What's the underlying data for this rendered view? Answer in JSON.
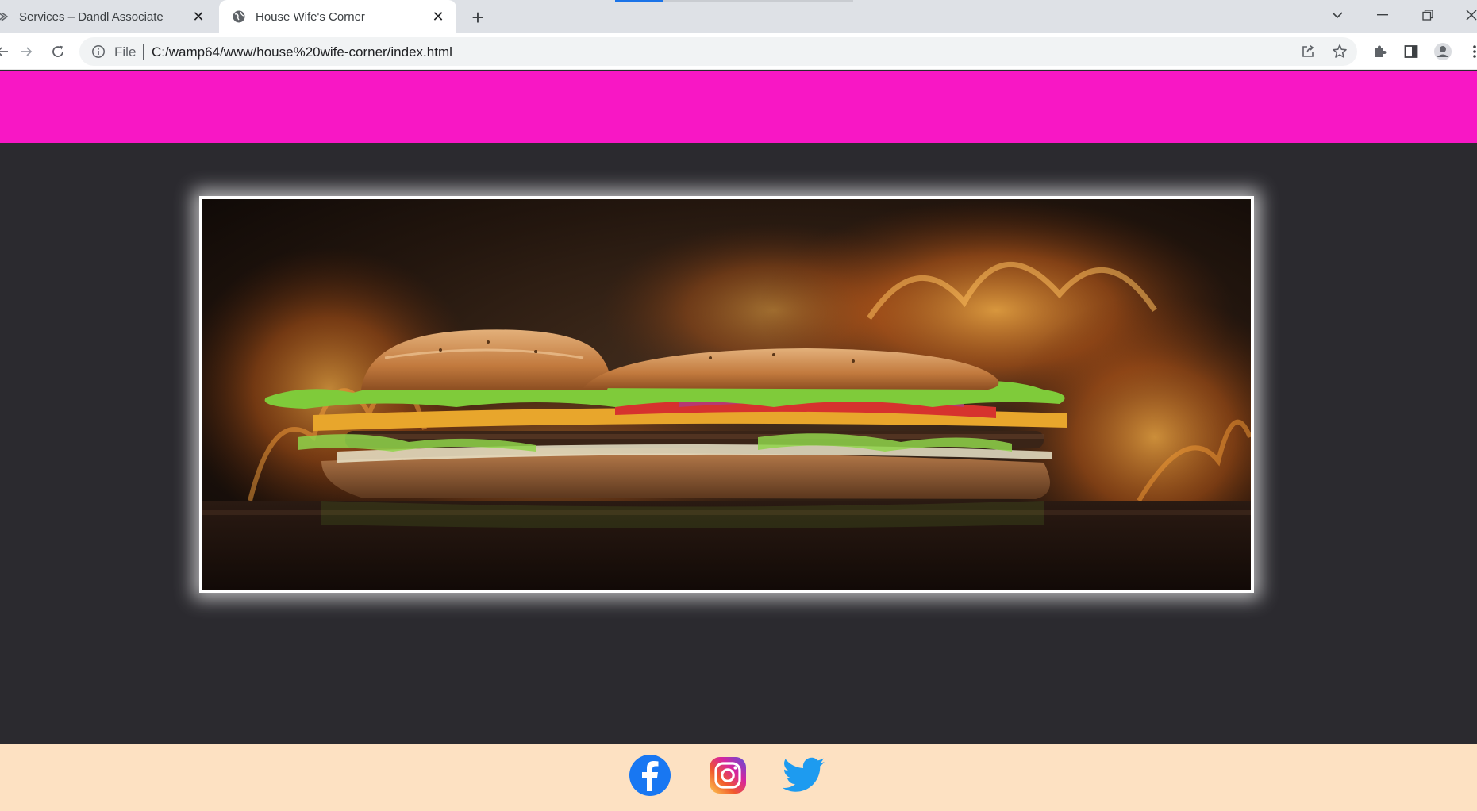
{
  "browser": {
    "tabs": [
      {
        "title": "Services – Dandl Associate",
        "active": false,
        "favicon": "site-favicon-icon"
      },
      {
        "title": "House Wife's Corner",
        "active": true,
        "favicon": "globe-icon"
      }
    ],
    "address": {
      "scheme_label": "File",
      "url": "C:/wamp64/www/house%20wife-corner/index.html"
    }
  },
  "page": {
    "header_color": "#f817c5",
    "body_color": "#2b2a2f",
    "footer_color": "#fde1c2",
    "hero": {
      "description": "burger-with-flames"
    },
    "social_links": [
      {
        "icon": "facebook-icon",
        "color": "#1877f2"
      },
      {
        "icon": "instagram-icon",
        "color": "#d6249f"
      },
      {
        "icon": "twitter-icon",
        "color": "#1d9bf0"
      }
    ]
  }
}
